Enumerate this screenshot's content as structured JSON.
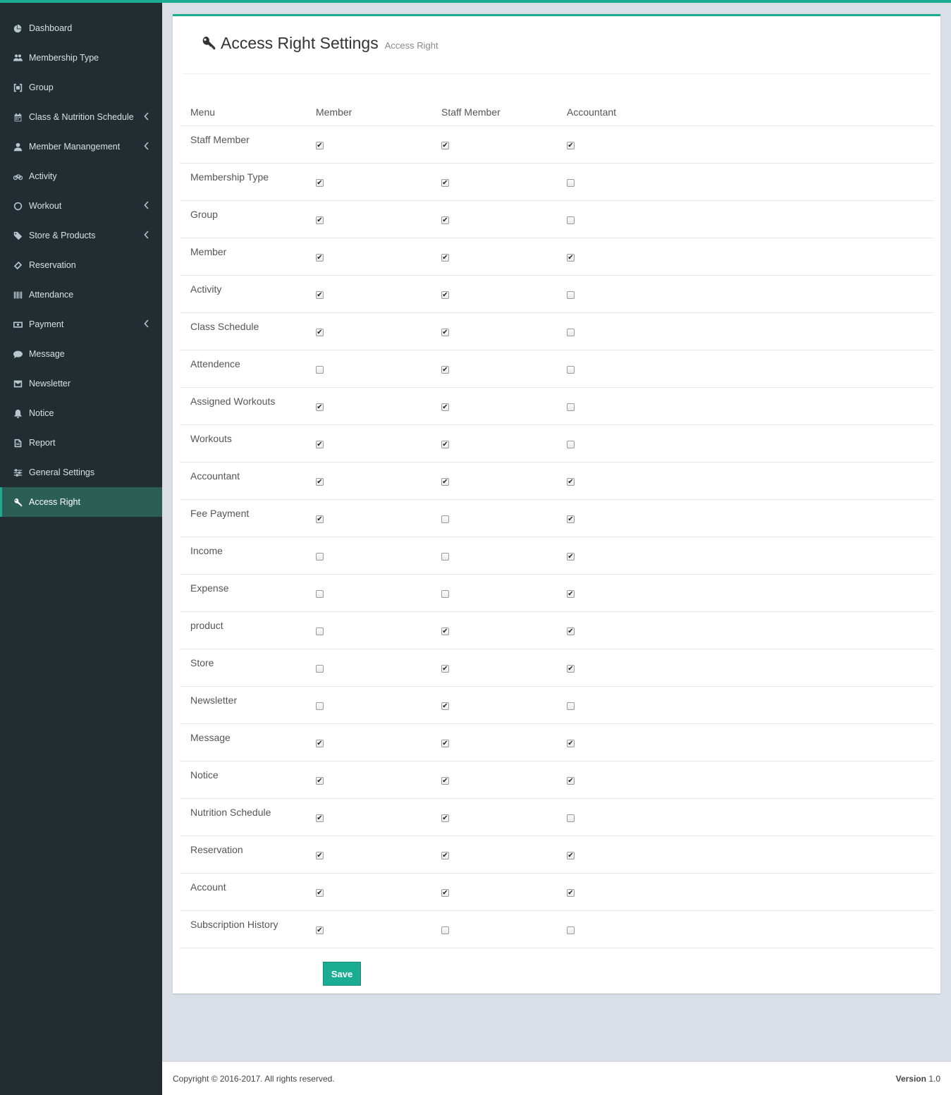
{
  "sidebar": {
    "items": [
      {
        "label": "Dashboard",
        "icon": "pie-chart-icon",
        "chevron": false,
        "active": false
      },
      {
        "label": "Membership Type",
        "icon": "users-icon",
        "chevron": false,
        "active": false
      },
      {
        "label": "Group",
        "icon": "group-icon",
        "chevron": false,
        "active": false
      },
      {
        "label": "Class & Nutrition Schedule",
        "icon": "calendar-icon",
        "chevron": true,
        "active": false
      },
      {
        "label": "Member Manangement",
        "icon": "user-icon",
        "chevron": true,
        "active": false
      },
      {
        "label": "Activity",
        "icon": "bicycle-icon",
        "chevron": false,
        "active": false
      },
      {
        "label": "Workout",
        "icon": "lemon-icon",
        "chevron": true,
        "active": false
      },
      {
        "label": "Store & Products",
        "icon": "tags-icon",
        "chevron": true,
        "active": false
      },
      {
        "label": "Reservation",
        "icon": "ticket-icon",
        "chevron": false,
        "active": false
      },
      {
        "label": "Attendance",
        "icon": "barcode-icon",
        "chevron": false,
        "active": false
      },
      {
        "label": "Payment",
        "icon": "money-icon",
        "chevron": true,
        "active": false
      },
      {
        "label": "Message",
        "icon": "comment-icon",
        "chevron": false,
        "active": false
      },
      {
        "label": "Newsletter",
        "icon": "envelope-icon",
        "chevron": false,
        "active": false
      },
      {
        "label": "Notice",
        "icon": "bell-icon",
        "chevron": false,
        "active": false
      },
      {
        "label": "Report",
        "icon": "file-icon",
        "chevron": false,
        "active": false
      },
      {
        "label": "General Settings",
        "icon": "sliders-icon",
        "chevron": false,
        "active": false
      },
      {
        "label": "Access Right",
        "icon": "key-icon",
        "chevron": false,
        "active": true
      }
    ]
  },
  "page": {
    "title": "Access Right Settings",
    "subtitle": "Access Right",
    "icon": "key-icon"
  },
  "table": {
    "headers": [
      "Menu",
      "Member",
      "Staff Member",
      "Accountant"
    ],
    "rows": [
      {
        "menu": "Staff Member",
        "member": true,
        "staff": true,
        "accountant": true
      },
      {
        "menu": "Membership Type",
        "member": true,
        "staff": true,
        "accountant": false
      },
      {
        "menu": "Group",
        "member": true,
        "staff": true,
        "accountant": false
      },
      {
        "menu": "Member",
        "member": true,
        "staff": true,
        "accountant": true
      },
      {
        "menu": "Activity",
        "member": true,
        "staff": true,
        "accountant": false
      },
      {
        "menu": "Class Schedule",
        "member": true,
        "staff": true,
        "accountant": false
      },
      {
        "menu": "Attendence",
        "member": false,
        "staff": true,
        "accountant": false
      },
      {
        "menu": "Assigned Workouts",
        "member": true,
        "staff": true,
        "accountant": false
      },
      {
        "menu": "Workouts",
        "member": true,
        "staff": true,
        "accountant": false
      },
      {
        "menu": "Accountant",
        "member": true,
        "staff": true,
        "accountant": true
      },
      {
        "menu": "Fee Payment",
        "member": true,
        "staff": false,
        "accountant": true
      },
      {
        "menu": "Income",
        "member": false,
        "staff": false,
        "accountant": true
      },
      {
        "menu": "Expense",
        "member": false,
        "staff": false,
        "accountant": true
      },
      {
        "menu": "product",
        "member": false,
        "staff": true,
        "accountant": true
      },
      {
        "menu": "Store",
        "member": false,
        "staff": true,
        "accountant": true
      },
      {
        "menu": "Newsletter",
        "member": false,
        "staff": true,
        "accountant": false
      },
      {
        "menu": "Message",
        "member": true,
        "staff": true,
        "accountant": true
      },
      {
        "menu": "Notice",
        "member": true,
        "staff": true,
        "accountant": true
      },
      {
        "menu": "Nutrition Schedule",
        "member": true,
        "staff": true,
        "accountant": false
      },
      {
        "menu": "Reservation",
        "member": true,
        "staff": true,
        "accountant": true
      },
      {
        "menu": "Account",
        "member": true,
        "staff": true,
        "accountant": true
      },
      {
        "menu": "Subscription History",
        "member": true,
        "staff": false,
        "accountant": false
      }
    ]
  },
  "save_label": "Save",
  "footer": {
    "copyright": "Copyright © 2016-2017. All rights reserved.",
    "version_label": "Version",
    "version": "1.0"
  },
  "colors": {
    "accent": "#1aad94",
    "sidebar_bg": "#222d32",
    "active_bg": "#2b5f55"
  }
}
